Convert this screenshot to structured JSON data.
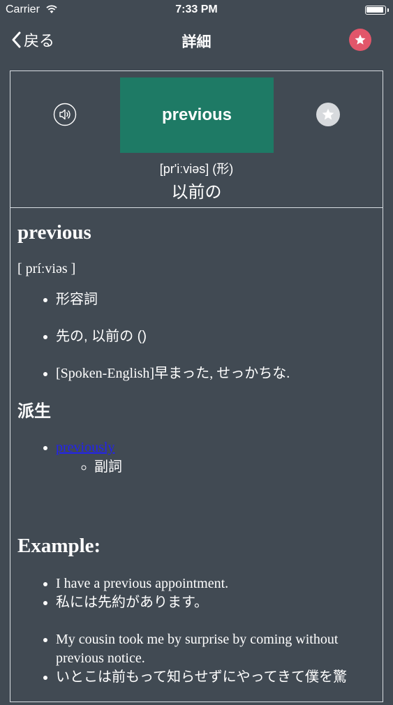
{
  "status_bar": {
    "carrier": "Carrier",
    "time": "7:33 PM"
  },
  "nav": {
    "back_label": "戻る",
    "title": "詳細",
    "favorite_icon": "star-icon",
    "accent_color": "#e2566a"
  },
  "header": {
    "word": "previous",
    "pronunciation": "[pr'iːviəs] (形)",
    "meaning": "以前の",
    "tile_color": "#1e7a65"
  },
  "entry": {
    "headword": "previous",
    "phonetic": "[ príːviəs ]",
    "definitions": [
      "形容詞",
      "先の, 以前の ()",
      "[Spoken-English]早まった, せっかちな."
    ],
    "derived_title": "派生",
    "derived": [
      {
        "word": "previously",
        "pos": "副詞"
      }
    ],
    "example_title": "Example:",
    "examples": [
      {
        "en": "I have a previous appointment.",
        "ja": "私には先約があります。"
      },
      {
        "en": "My cousin took me by surprise by coming without previous notice.",
        "ja": "いとこは前もって知らせずにやってきて僕を驚"
      }
    ]
  }
}
